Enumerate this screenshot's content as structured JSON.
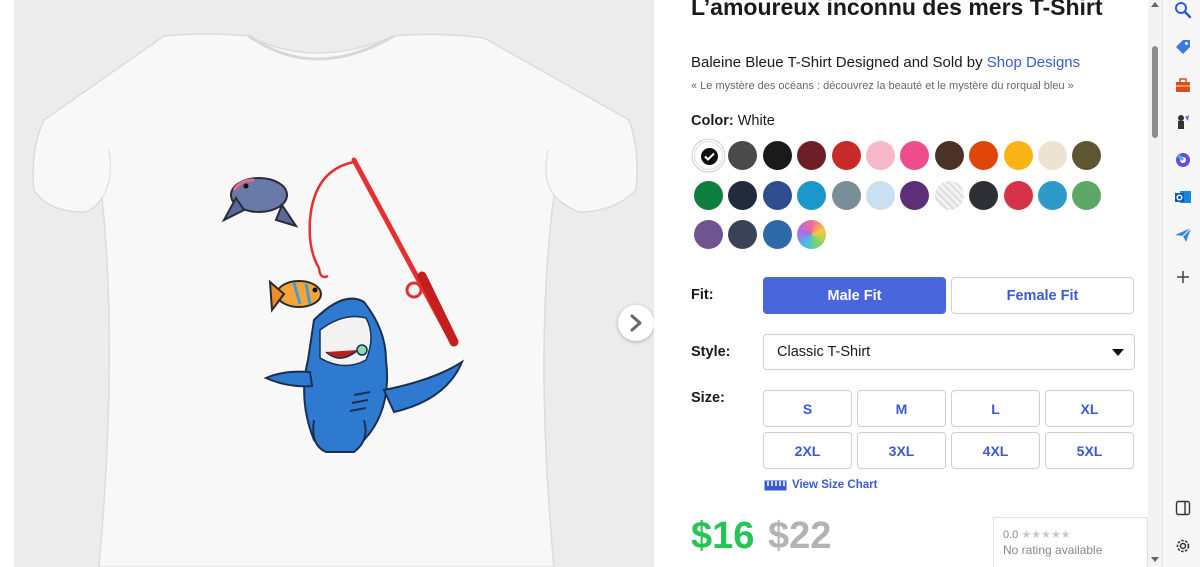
{
  "product": {
    "title": "L’amoureux inconnu des mers T-Shirt",
    "byline_prefix": "Baleine Bleue T-Shirt Designed and Sold by ",
    "designer": "Shop Designs",
    "tagline": "« Le mystère des océans : découvrez la beauté et le mystère du rorqual bleu »"
  },
  "color": {
    "label": "Color:",
    "selected": "White",
    "swatches": [
      "#ffffff",
      "#4a4a4a",
      "#1a1a1a",
      "#6e1e26",
      "#c82a2a",
      "#f7b8c8",
      "#ef4c8c",
      "#4a3326",
      "#e0460c",
      "#fbb416",
      "#ece4d0",
      "#5e5630",
      "#0e7e3e",
      "#222a3e",
      "#2e4e90",
      "#1a98cc",
      "#7a8e98",
      "#c8e0f0",
      "#5e2e78",
      "#e8e8e8",
      "#2e3036",
      "#d63248",
      "#2e9ac8",
      "#5ea866",
      "#6e5490",
      "#3a4256",
      "#2e6aa8",
      "tie-dye"
    ]
  },
  "fit": {
    "label": "Fit:",
    "options": [
      "Male Fit",
      "Female Fit"
    ],
    "selected": "Male Fit"
  },
  "style": {
    "label": "Style:",
    "value": "Classic T-Shirt"
  },
  "size": {
    "label": "Size:",
    "options": [
      "S",
      "M",
      "L",
      "XL",
      "2XL",
      "3XL",
      "4XL",
      "5XL"
    ],
    "chart_link": "View Size Chart"
  },
  "price": {
    "sale": "$16",
    "original": "$22"
  },
  "rating": {
    "score": "0.0",
    "stars": "★★★★★",
    "text": "No rating available"
  },
  "sidebar_icons": [
    "search-icon",
    "tag-icon",
    "toolbox-icon",
    "chess-icon",
    "copilot-icon",
    "outlook-icon",
    "send-icon",
    "add-icon",
    "split-screen-icon",
    "gear-icon"
  ],
  "colors": {
    "accent": "#4a66dc",
    "link": "#3a5ad1",
    "sale_price": "#26c454",
    "original_price": "#b3b3b3"
  }
}
